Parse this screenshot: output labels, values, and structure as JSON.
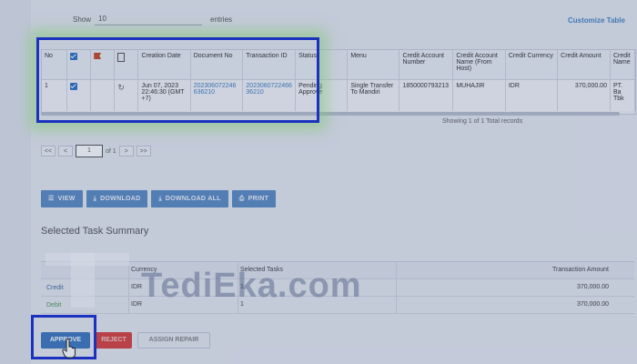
{
  "toolbar": {
    "show_label": "Show",
    "show_value": "10",
    "entries_label": "entries",
    "customize": "Customize Table"
  },
  "table": {
    "columns": [
      "No",
      "",
      "",
      "",
      "Creation Date",
      "Document No",
      "Transaction ID",
      "Status",
      "Menu",
      "Credit Account Number",
      "Credit Account Name (From Host)",
      "Credit Currency",
      "Credit Amount",
      "Credit Name"
    ],
    "row": {
      "no": "1",
      "creation_date": "Jun 07, 2023 22:46:30 (GMT +7)",
      "document_no": "202306072246636210",
      "transaction_id": "202306072246636210",
      "status": "Pending Approve",
      "menu": "Single Transfer To Mandiri",
      "credit_account_number": "1850000793213",
      "credit_account_name": "MUHAJIR",
      "credit_currency": "IDR",
      "credit_amount": "370,000.00",
      "credit_name": "PT. Ba Tbk"
    },
    "records": "Showing 1 of 1 Total records"
  },
  "pager": {
    "first": "<<",
    "prev": "<",
    "page": "1",
    "of": "of 1",
    "next": ">",
    "last": ">>"
  },
  "actions": {
    "view": "VIEW",
    "download": "DOWNLOAD",
    "download_all": "DOWNLOAD ALL",
    "print": "PRINT"
  },
  "summary": {
    "title": "Selected Task Summary",
    "headers": [
      "",
      "Currency",
      "Selected Tasks",
      "Transaction Amount"
    ],
    "rows": [
      {
        "label": "Credit",
        "currency": "IDR",
        "tasks": "1",
        "amount": "370,000.00"
      },
      {
        "label": "Debit",
        "currency": "IDR",
        "tasks": "1",
        "amount": "370,000.00"
      }
    ]
  },
  "bottom": {
    "approve": "APPROVE",
    "reject": "REJECT",
    "assign_repair": "ASSIGN REPAIR"
  },
  "watermark": {
    "text": "TediEka.com"
  },
  "colors": {
    "highlight": "#1a2fd1",
    "primary_button": "#3f79c0",
    "reject_button": "#d8443f",
    "link": "#3f7fbf"
  }
}
